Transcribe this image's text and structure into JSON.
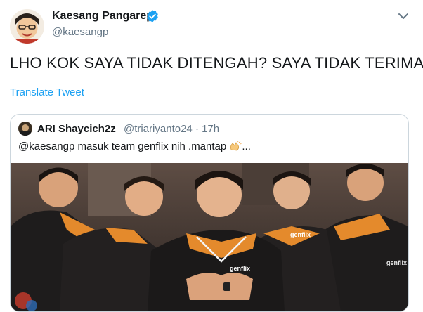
{
  "tweet": {
    "author_name": "Kaesang Pangarep",
    "author_handle": "@kaesangp",
    "text": "LHO KOK SAYA TIDAK DITENGAH? SAYA TIDAK TERIMA",
    "translate_label": "Translate Tweet"
  },
  "quoted_tweet": {
    "author_name": "ARI Shaycich2z",
    "author_handle": "@triariyanto24",
    "separator": "·",
    "time": "17h",
    "text_before": "@kaesangp masuk team genflix nih .mantap ",
    "text_after": "..."
  },
  "photo": {
    "sponsor": "genflix"
  },
  "colors": {
    "link": "#1da1f2",
    "verified": "#1da1f2",
    "secondary_text": "#657786",
    "border": "#ccd6dd",
    "jersey_orange": "#e48a2c"
  },
  "icons": [
    "verified-badge-icon",
    "chevron-down-icon",
    "clapping-hands-emoji-icon"
  ]
}
